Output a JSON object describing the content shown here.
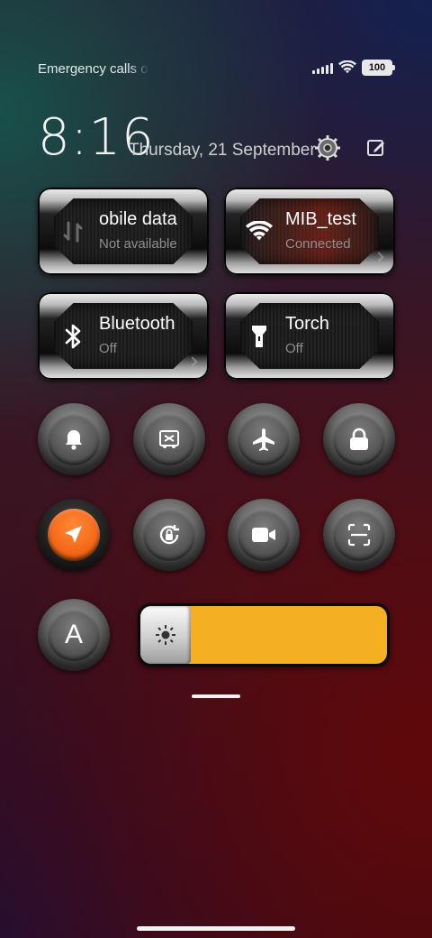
{
  "status_bar": {
    "carrier_text": "Emergency calls o",
    "battery_level": "100"
  },
  "header": {
    "time": "8:16",
    "date": "Thursday, 21 September"
  },
  "tiles": [
    {
      "title": "obile data",
      "subtitle": "Not available",
      "icon": "mobile-data-icon"
    },
    {
      "title": "MIB_test",
      "subtitle": "Connected",
      "icon": "wifi-icon"
    },
    {
      "title": "Bluetooth",
      "subtitle": "Off",
      "icon": "bluetooth-icon"
    },
    {
      "title": "Torch",
      "subtitle": "Off",
      "icon": "torch-icon"
    }
  ],
  "quick_buttons": [
    {
      "icon": "bell-icon",
      "active": false
    },
    {
      "icon": "screen-cast-icon",
      "active": false
    },
    {
      "icon": "airplane-icon",
      "active": false
    },
    {
      "icon": "lock-icon",
      "active": false
    },
    {
      "icon": "location-icon",
      "active": true
    },
    {
      "icon": "rotation-lock-icon",
      "active": false
    },
    {
      "icon": "video-camera-icon",
      "active": false
    },
    {
      "icon": "scan-icon",
      "active": false
    }
  ],
  "auto_brightness": {
    "label": "A"
  },
  "brightness": {
    "level": 0.05,
    "icon": "sun-icon"
  },
  "colors": {
    "active_accent": "#f36716",
    "brightness_fill": "#f4b022"
  }
}
